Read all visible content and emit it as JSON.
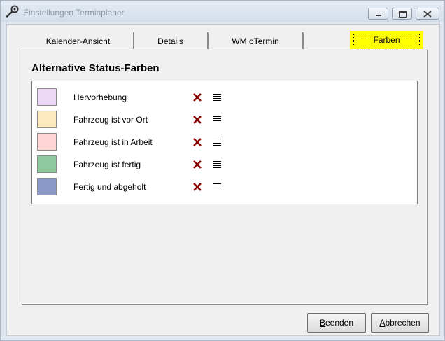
{
  "window": {
    "title": "Einstellungen Terminplaner"
  },
  "tabs": [
    {
      "label": "Kalender-Ansicht"
    },
    {
      "label": "Details"
    },
    {
      "label": "WM oTermin"
    },
    {
      "label": "Farben",
      "active": true,
      "highlight_color": "#ffff00"
    }
  ],
  "section": {
    "title": "Alternative Status-Farben"
  },
  "status_colors": [
    {
      "label": "Hervorhebung",
      "color": "#ecd8f6"
    },
    {
      "label": "Fahrzeug ist vor Ort",
      "color": "#fde9be"
    },
    {
      "label": "Fahrzeug ist in Arbeit",
      "color": "#fdd5d5"
    },
    {
      "label": "Fahrzeug ist fertig",
      "color": "#8dc99c"
    },
    {
      "label": "Fertig und abgeholt",
      "color": "#8b99c8"
    }
  ],
  "row_icons": {
    "delete": "delete-x-icon",
    "list": "list-lines-icon"
  },
  "buttons": {
    "beenden": {
      "accel": "B",
      "rest": "eenden"
    },
    "abbrechen": {
      "accel": "A",
      "rest": "bbrechen"
    }
  }
}
